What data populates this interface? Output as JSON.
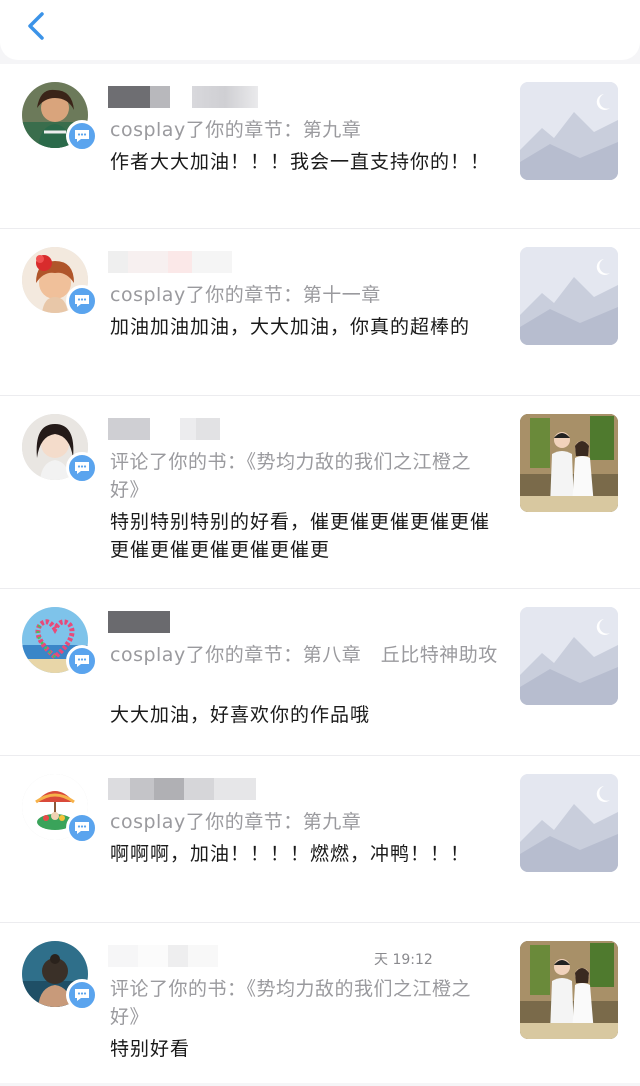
{
  "header": {
    "back_icon": "chevron-left-icon"
  },
  "colors": {
    "accent": "#3b93e8",
    "badge": "#5aa4ee",
    "secondary_text": "#9a9a9e",
    "primary_text": "#1a1a1a"
  },
  "notifications": [
    {
      "action": "cosplay了你的章节：第九章",
      "comment": "作者大大加油！！！我会一直支持你的！！",
      "thumb": "placeholder-mountain-image",
      "badge_icon": "chat-bubble-icon"
    },
    {
      "action": "cosplay了你的章节：第十一章",
      "comment": "加油加油加油，大大加油，你真的超棒的",
      "thumb": "placeholder-mountain-image",
      "badge_icon": "chat-bubble-icon"
    },
    {
      "action": "评论了你的书：《势均力敌的我们之江橙之好》",
      "comment": "特别特别特别的好看，催更催更催更催更催更催更催更催更催更催更",
      "thumb": "couple-photo",
      "badge_icon": "chat-bubble-icon"
    },
    {
      "action": "cosplay了你的章节：第八章　丘比特神助攻",
      "comment": "大大加油，好喜欢你的作品哦",
      "thumb": "placeholder-mountain-image",
      "badge_icon": "chat-bubble-icon"
    },
    {
      "action": "cosplay了你的章节：第九章",
      "comment": "啊啊啊，加油！！！！燃燃，冲鸭！！！",
      "thumb": "placeholder-mountain-image",
      "badge_icon": "chat-bubble-icon"
    },
    {
      "action": "评论了你的书：《势均力敌的我们之江橙之好》",
      "comment": "特别好看",
      "timestamp": "天 19:12",
      "thumb": "couple-photo",
      "badge_icon": "chat-bubble-icon"
    }
  ]
}
